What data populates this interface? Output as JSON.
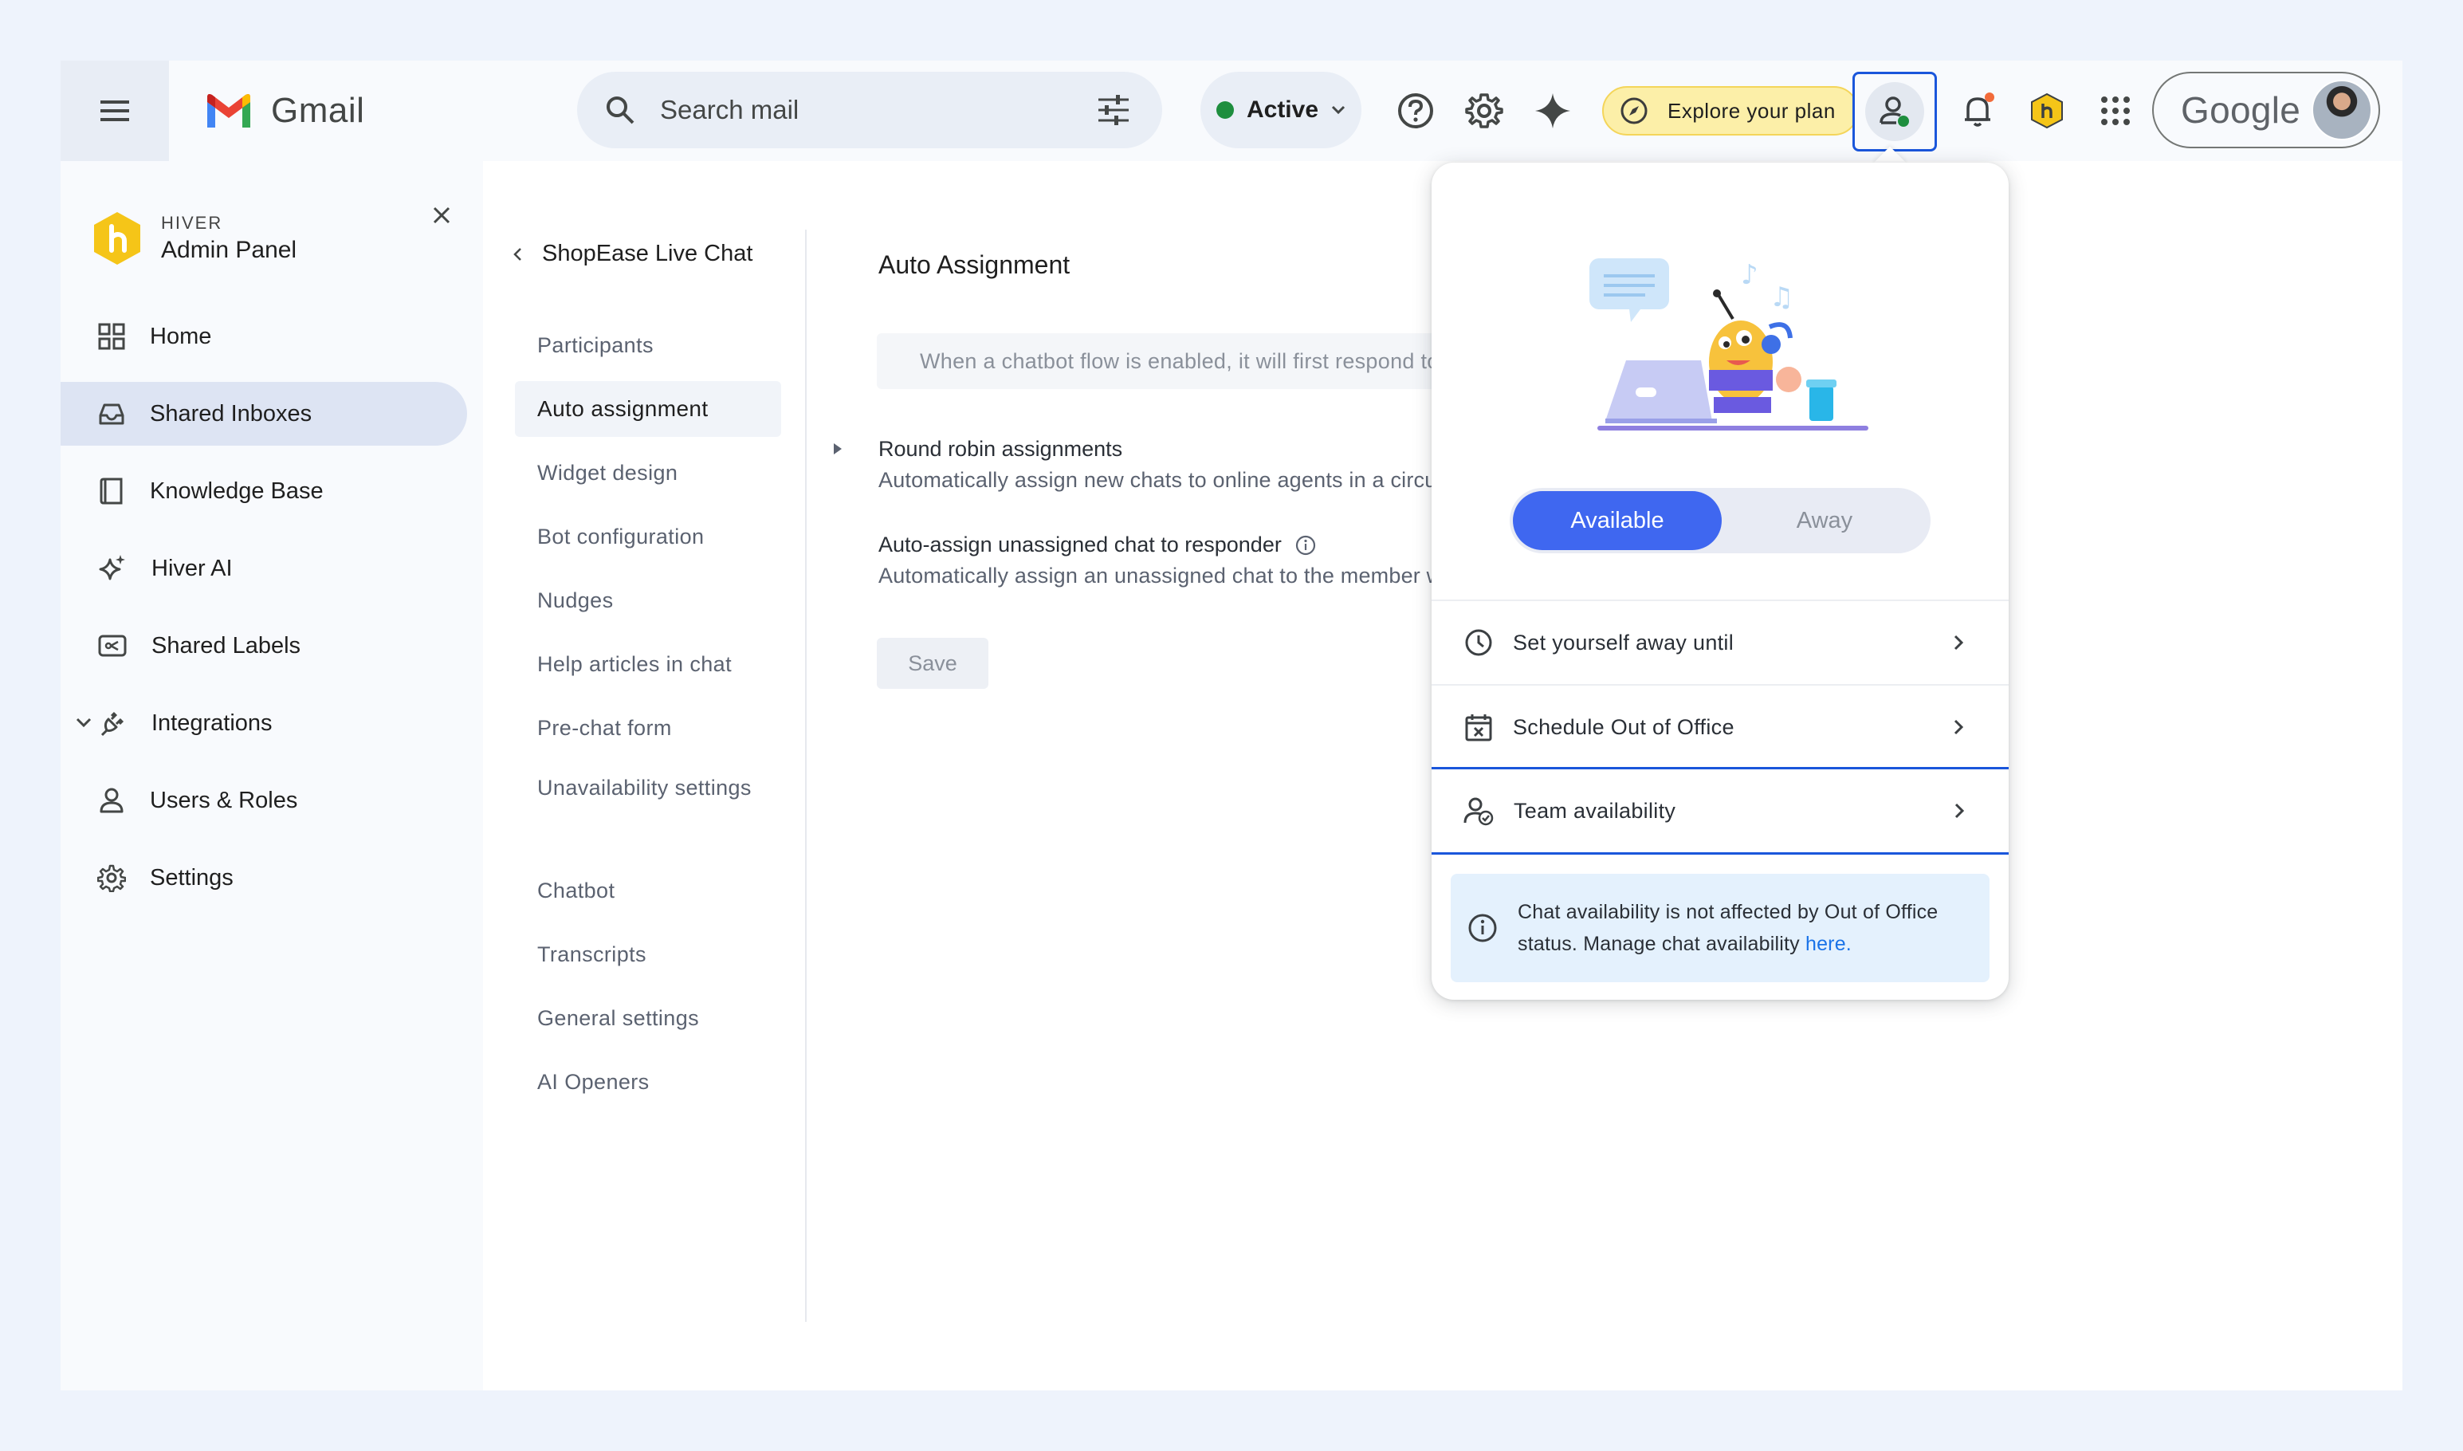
{
  "gmail": {
    "app_name": "Gmail",
    "search_placeholder": "Search mail",
    "status": "Active",
    "explore": "Explore your plan",
    "account": "Google"
  },
  "sidebar": {
    "brand_small": "HIVER",
    "brand_title": "Admin Panel",
    "items": [
      {
        "label": "Home",
        "icon": "grid-icon"
      },
      {
        "label": "Shared Inboxes",
        "icon": "inbox-icon",
        "active": true
      },
      {
        "label": "Knowledge Base",
        "icon": "book-icon"
      },
      {
        "label": "Hiver AI",
        "icon": "sparkle-icon"
      },
      {
        "label": "Shared Labels",
        "icon": "label-icon"
      },
      {
        "label": "Integrations",
        "icon": "plug-icon"
      },
      {
        "label": "Users & Roles",
        "icon": "user-icon"
      },
      {
        "label": "Settings",
        "icon": "gear-icon"
      }
    ]
  },
  "subnav": {
    "title": "ShopEase Live Chat",
    "items": [
      "Participants",
      "Auto assignment",
      "Widget design",
      "Bot configuration",
      "Nudges",
      "Help articles in chat",
      "Pre-chat form",
      "Unavailability settings",
      "Chatbot",
      "Transcripts",
      "General settings",
      "AI Openers"
    ]
  },
  "main": {
    "title": "Auto Assignment",
    "banner": "When a chatbot flow is enabled, it will first respond to new chats before assigning",
    "round_robin_title": "Round robin assignments",
    "round_robin_desc": "Automatically assign new chats to online agents in a circular manner",
    "auto_assign_title": "Auto-assign unassigned chat to responder",
    "auto_assign_desc": "Automatically assign an unassigned chat to the member who responds first",
    "save": "Save"
  },
  "popover": {
    "available": "Available",
    "away": "Away",
    "rows": [
      {
        "label": "Set yourself away until",
        "icon": "clock-icon"
      },
      {
        "label": "Schedule Out of Office",
        "icon": "calendar-x-icon"
      },
      {
        "label": "Team availability",
        "icon": "team-check-icon"
      }
    ],
    "note": "Chat availability is not affected by Out of Office status. Manage chat availability",
    "note_link": "here."
  },
  "colors": {
    "accent": "#3f67f0",
    "selection": "#1a56db",
    "hiver_yellow": "#f5c518",
    "active_green": "#1e8e3e"
  }
}
